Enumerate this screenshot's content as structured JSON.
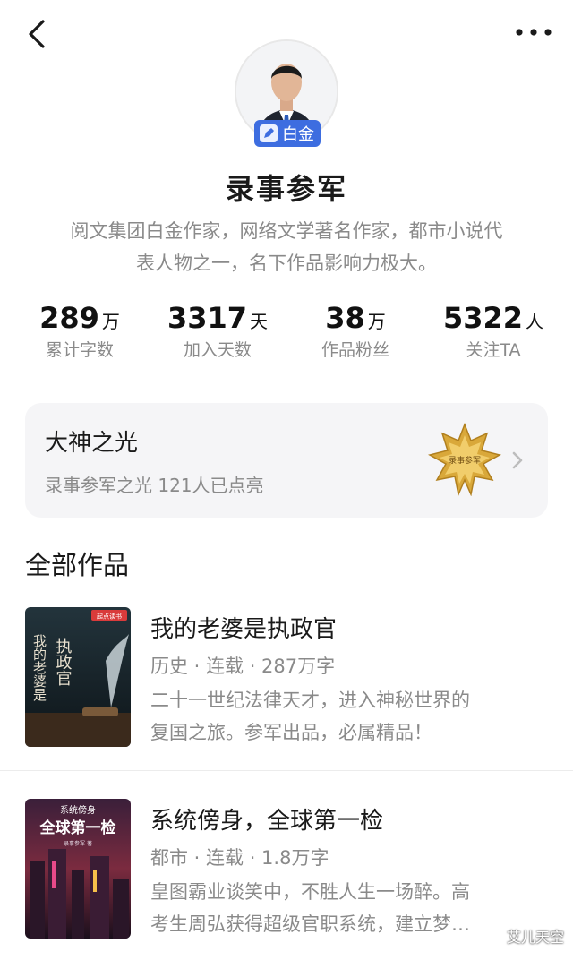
{
  "header": {
    "back_icon": "chevron-left-icon",
    "more_icon": "more-dots-icon"
  },
  "profile": {
    "badge_label": "白金",
    "name": "录事参军",
    "bio_line1": "阅文集团白金作家，网络文学著名作家，都市小说代",
    "bio_line2": "表人物之一，名下作品影响力极大。"
  },
  "stats": [
    {
      "value": "289",
      "unit": "万",
      "label": "累计字数"
    },
    {
      "value": "3317",
      "unit": "天",
      "label": "加入天数"
    },
    {
      "value": "38",
      "unit": "万",
      "label": "作品粉丝"
    },
    {
      "value": "5322",
      "unit": "人",
      "label": "关注TA"
    }
  ],
  "honor_card": {
    "title": "大神之光",
    "subtitle": "录事参军之光 121人已点亮",
    "medal_text": "录事参军"
  },
  "works": {
    "section_title": "全部作品",
    "items": [
      {
        "title": "我的老婆是执政官",
        "meta": "历史 · 连载 · 287万字",
        "desc_line1": "二十一世纪法律天才，进入神秘世界的",
        "desc_line2": "复国之旅。参军出品，必属精品！",
        "cover_publisher": "起点读书",
        "cover_title_a": "我的老婆是",
        "cover_title_b": "执政官"
      },
      {
        "title": "系统傍身，全球第一检",
        "meta": "都市 · 连载 · 1.8万字",
        "desc_line1": "皇图霸业谈笑中，不胜人生一场醉。高",
        "desc_line2": "考生周弘获得超级官职系统，建立梦…",
        "cover_small": "系统傍身",
        "cover_big": "全球第一检",
        "cover_author": "录事参军 著"
      }
    ]
  },
  "watermark": "艾儿天空",
  "colors": {
    "badge": "#3d6de0",
    "card_bg": "#f5f5f7",
    "muted": "#8a8a8a",
    "medal_gold": "#d9a83a"
  }
}
